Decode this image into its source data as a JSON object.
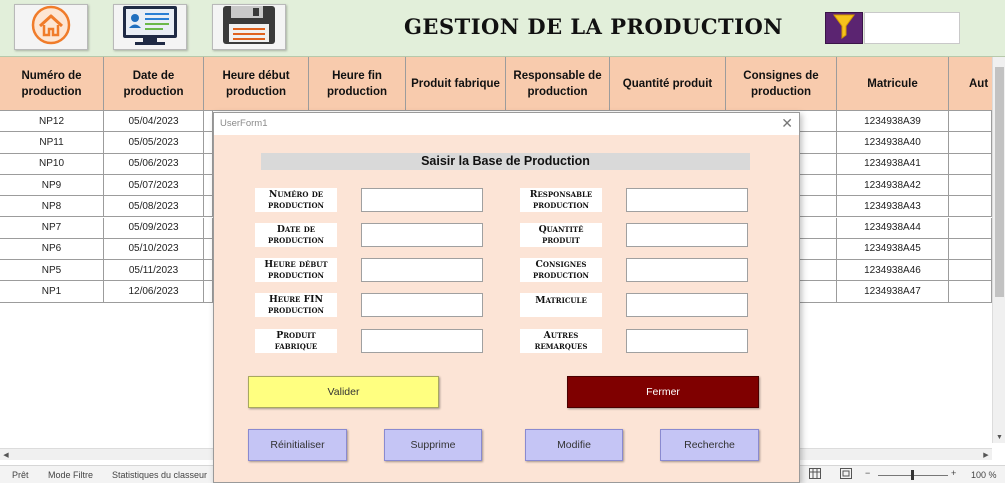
{
  "banner": {
    "title": "GESTION DE LA PRODUCTION",
    "buttons": [
      {
        "icon": "home-icon"
      },
      {
        "icon": "employee-card-icon"
      },
      {
        "icon": "save-disk-icon"
      }
    ],
    "filter_icon": "filter-funnel-icon",
    "filter_value": "",
    "colors": {
      "banner_bg": "#e2efda",
      "filter_bg": "#5b2471",
      "funnel": "#f6c21c"
    }
  },
  "table": {
    "headers": [
      "Numéro de production",
      "Date de production",
      "Heure début production",
      "Heure fin production",
      "Produit fabrique",
      "Responsable de production",
      "Quantité produit",
      "Consignes de production",
      "Matricule",
      "Aut"
    ],
    "rows": [
      {
        "num": "NP12",
        "date": "05/04/2023",
        "mat": "1234938A39"
      },
      {
        "num": "NP11",
        "date": "05/05/2023",
        "mat": "1234938A40"
      },
      {
        "num": "NP10",
        "date": "05/06/2023",
        "mat": "1234938A41"
      },
      {
        "num": "NP9",
        "date": "05/07/2023",
        "mat": "1234938A42"
      },
      {
        "num": "NP8",
        "date": "05/08/2023",
        "mat": "1234938A43"
      },
      {
        "num": "NP7",
        "date": "05/09/2023",
        "mat": "1234938A44"
      },
      {
        "num": "NP6",
        "date": "05/10/2023",
        "mat": "1234938A45"
      },
      {
        "num": "NP5",
        "date": "05/11/2023",
        "mat": "1234938A46"
      },
      {
        "num": "NP1",
        "date": "12/06/2023",
        "mat": "1234938A47"
      }
    ],
    "header_bg": "#f8cbad"
  },
  "form": {
    "window_title": "UserForm1",
    "close_glyph": "✕",
    "heading": "Saisir la Base de Production",
    "left_labels": [
      "Numéro de production",
      "Date de production",
      "Heure début production",
      "Heure FIN production",
      "Produit fabrique"
    ],
    "right_labels": [
      "Responsable production",
      "Quantité produit",
      "Consignes production",
      "Matricule",
      "Autres remarques"
    ],
    "buttons": {
      "valider": "Valider",
      "fermer": "Fermer",
      "reinitialiser": "Réinitialiser",
      "supprime": "Supprime",
      "modifie": "Modifie",
      "recherche": "Recherche"
    },
    "colors": {
      "form_bg": "#fce4d6",
      "valider": "#ffff80",
      "fermer": "#7f0000",
      "action": "#c5c5f5"
    }
  },
  "status": {
    "ready": "Prêt",
    "mode": "Mode Filtre",
    "stats": "Statistiques du classeur",
    "zoom": "100 %",
    "zoom_minus": "−",
    "zoom_plus": "+"
  }
}
